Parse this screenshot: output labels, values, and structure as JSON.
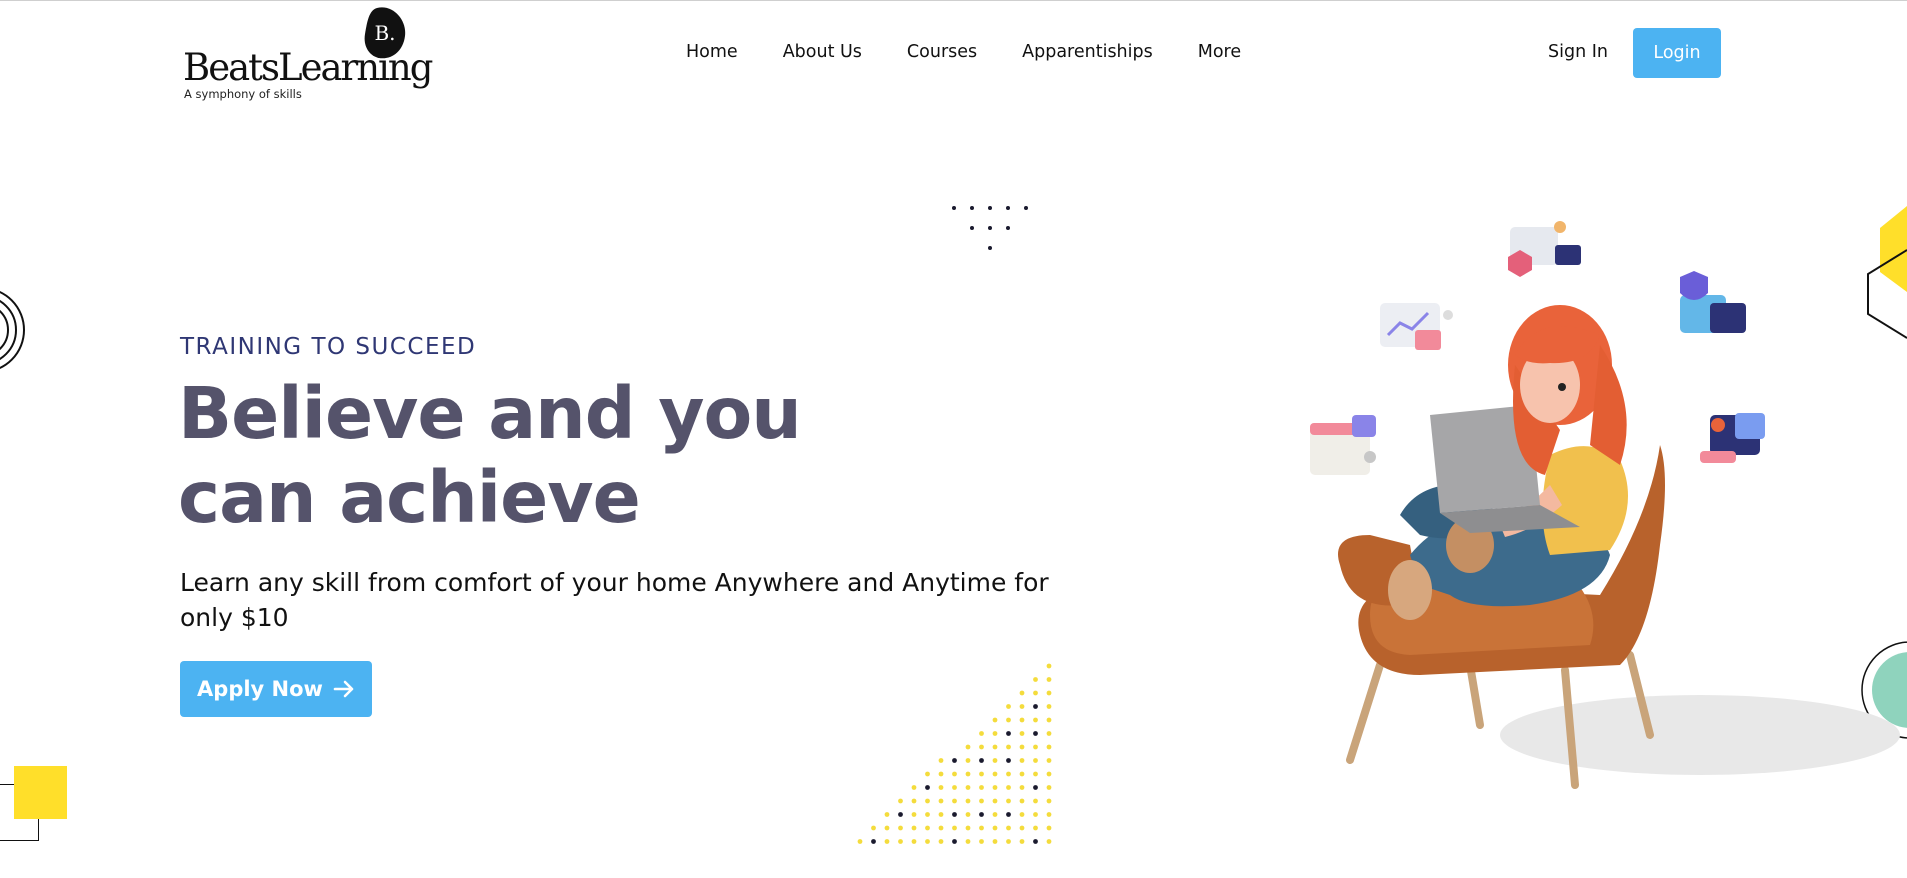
{
  "brand": {
    "name": "BeatsLearning",
    "mark": "B.",
    "tagline": "A symphony of skills"
  },
  "nav": {
    "items": [
      {
        "label": "Home"
      },
      {
        "label": "About Us"
      },
      {
        "label": "Courses"
      },
      {
        "label": "Apparentiships"
      },
      {
        "label": "More"
      }
    ]
  },
  "auth": {
    "signin_label": "Sign In",
    "login_label": "Login"
  },
  "hero": {
    "eyebrow": "TRAINING TO SUCCEED",
    "headline": "Believe and you can achieve",
    "subtext": "Learn any skill from comfort of your home Anywhere and Anytime for only $10",
    "cta_label": "Apply Now",
    "cta_icon": "arrow-right-icon"
  },
  "colors": {
    "accent": "#4cb3f2",
    "headline": "#55536b",
    "eyebrow": "#2f3774",
    "decor_yellow": "#ffdf2a"
  }
}
